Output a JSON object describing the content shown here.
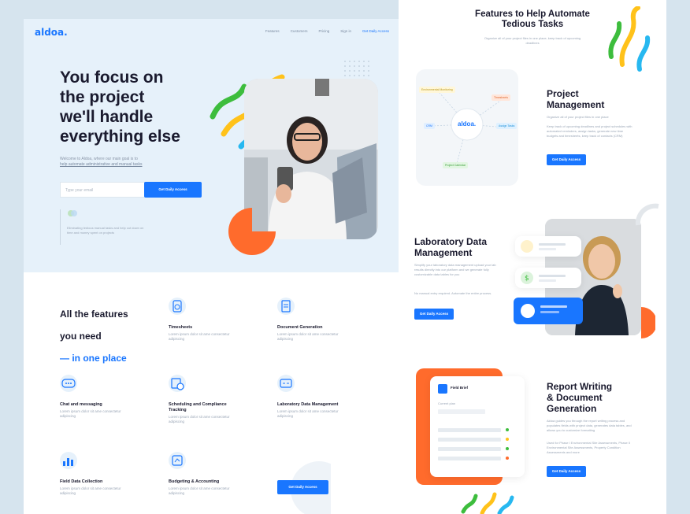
{
  "colors": {
    "brand": "#1976ff",
    "frame": "#d6e4ee",
    "hero_bg": "#e6f1fa",
    "orange": "#ff6b2c",
    "green": "#3dbd3d",
    "yellow": "#ffc21a",
    "cyan": "#27b8f0"
  },
  "nav": {
    "logo": "aldoa.",
    "links": [
      "Features",
      "Customers",
      "Pricing",
      "Sign in"
    ],
    "cta": "Get Daily Access"
  },
  "hero": {
    "headline": "You focus on\nthe project\nwe'll handle\neverything else",
    "subtitle_1": "Welcome to Aldoa, where our main goal is to",
    "subtitle_2": "help automate administrative and manual tasks",
    "email_placeholder": "Type your email",
    "button": "Get Daily Access",
    "note": "Eliminating tedious manual tasks and help cut down on time and money spent on projects"
  },
  "features": {
    "title_line1": "All the features",
    "title_line2": "you need",
    "title_line3": "— in one place",
    "items": [
      {
        "title": "Timesheets",
        "desc": "Lorem ipsum dolor sit ame consectetur adipiscing",
        "icon": "timesheet-icon"
      },
      {
        "title": "Document Generation",
        "desc": "Lorem ipsum dolor sit ame consectetur adipiscing",
        "icon": "document-icon"
      },
      {
        "title": "Chat and messaging",
        "desc": "Lorem ipsum dolor sit ame consectetur adipiscing",
        "icon": "chat-icon"
      },
      {
        "title": "Scheduling and Compliance Tracking",
        "desc": "Lorem ipsum dolor sit ame consectetur adipiscing",
        "icon": "schedule-icon"
      },
      {
        "title": "Laboratory Data Management",
        "desc": "Lorem ipsum dolor sit ame consectetur adipiscing",
        "icon": "lab-icon"
      },
      {
        "title": "Field Data Collection",
        "desc": "Lorem ipsum dolor sit ame consectetur adipiscing",
        "icon": "field-data-icon"
      },
      {
        "title": "Budgeting & Accounting",
        "desc": "Lorem ipsum dolor sit ame consectetur adipiscing",
        "icon": "budget-icon"
      }
    ],
    "button": "Get Daily Access"
  },
  "right": {
    "title": "Features to Help Automate\nTedious Tasks",
    "subtitle": "Organize all of your project files in one place, keep track of upcoming deadlines",
    "pm": {
      "title": "Project\nManagement",
      "text1": "Organize all of your project files in one place",
      "text2": "Keep track of upcoming deadlines and project schedules with automated reminders, assign tasks, generate new time budgets and timesheets, keep track of contacts (CRM)",
      "button": "Get Daily Access",
      "diagram": {
        "center": "aldoa.",
        "node_a": "Environmental Monitoring",
        "node_b": "Timesheets",
        "node_c": "CRM",
        "node_d": "Assign Tasks",
        "node_e": "Project Calendar"
      }
    },
    "lab": {
      "title": "Laboratory Data\nManagement",
      "text1": "Simplify your laboratory data management upload your lab results directly into our platform and we generate fully customizable data tables for you",
      "text2": "No manual entry required. Automate the entire process.",
      "button": "Get Daily Access"
    },
    "report": {
      "title": "Report Writing\n& Document\nGeneration",
      "text1": "Aldoa guides you through the report writing process and populates fields with project data, generates data tables, and allows you to customize formatting",
      "text2": "Used for Phase I Environmental Site Assessments, Phase II Environmental Site Assessments, Property Condition Assessments and more",
      "button": "Get Daily Access",
      "card_title": "Field Brief",
      "card_sub": "Current plan"
    }
  }
}
